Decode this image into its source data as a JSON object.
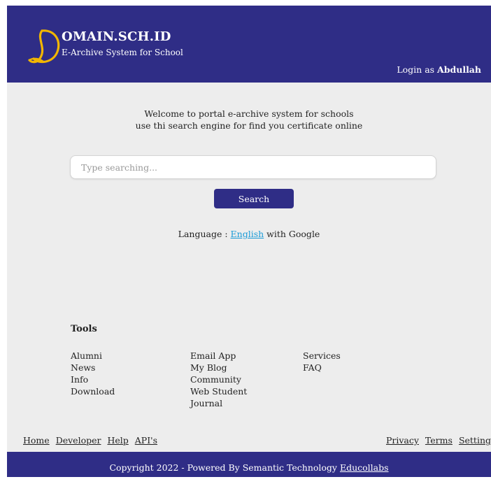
{
  "header": {
    "brand_name": "OMAIN.SCH.ID",
    "brand_subtitle": "E-Archive System for School",
    "logo_icon": "stylized-d-logo",
    "login_prefix": "Login as",
    "login_user": "Abdullah"
  },
  "main": {
    "welcome_line1": "Welcome to portal e-archive system for schools",
    "welcome_line2": "use thi search engine for find you certificate online",
    "search_placeholder": "Type searching...",
    "search_button": "Search",
    "language_prefix": "Language :",
    "language_link": "English",
    "language_suffix": "with Google"
  },
  "tools": {
    "title": "Tools",
    "col1": [
      "Alumni",
      "News",
      "Info",
      "Download"
    ],
    "col2": [
      "Email App",
      "My Blog",
      "Community",
      "Web Student",
      "Journal"
    ],
    "col3": [
      "Services",
      "FAQ"
    ]
  },
  "footer": {
    "left_links": [
      "Home",
      "Developer",
      "Help",
      "API's"
    ],
    "right_links": [
      "Privacy",
      "Terms",
      "Setting"
    ],
    "copyright": "Copyright 2022 - Powered By Semantic Technology",
    "copyright_link": "Educollabs"
  },
  "colors": {
    "primary": "#2f2d86",
    "logo_gold": "#f2b600",
    "link_blue": "#1b9bd7",
    "background": "#ededed"
  }
}
